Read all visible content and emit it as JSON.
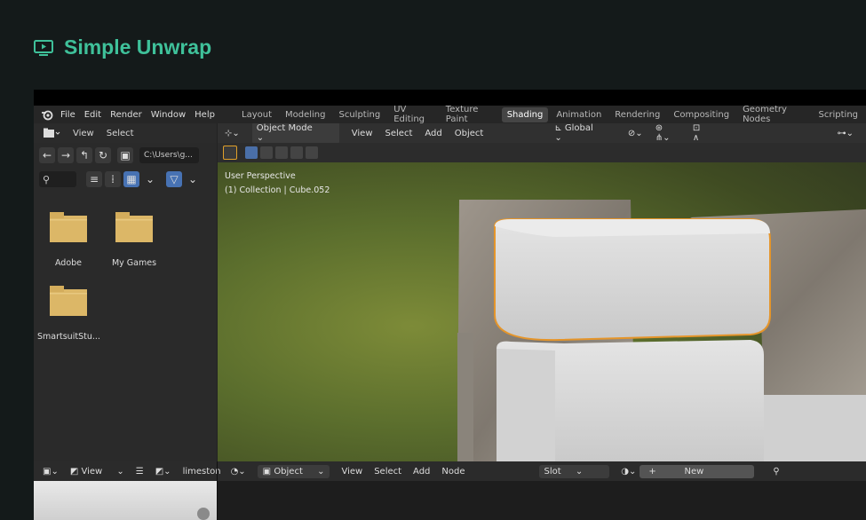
{
  "lesson": {
    "title": "Simple Unwrap",
    "icon": "play-screen-icon"
  },
  "blender": {
    "menu": [
      "File",
      "Edit",
      "Render",
      "Window",
      "Help"
    ],
    "workspace_tabs": [
      "Layout",
      "Modeling",
      "Sculpting",
      "UV Editing",
      "Texture Paint",
      "Shading",
      "Animation",
      "Rendering",
      "Compositing",
      "Geometry Nodes",
      "Scripting"
    ],
    "active_tab": "Shading",
    "file_browser": {
      "header": [
        "View",
        "Select"
      ],
      "path": "C:\\Users\\g...",
      "files": [
        "Adobe",
        "My Games",
        "SmartsuitStu..."
      ]
    },
    "viewport": {
      "mode": "Object Mode",
      "header": [
        "View",
        "Select",
        "Add",
        "Object"
      ],
      "transform": "Global",
      "perspective": "User Perspective",
      "collection": "(1) Collection | Cube.052"
    },
    "image_editor": {
      "view": "View",
      "image_name": "limestone"
    },
    "node_editor": {
      "object": "Object",
      "header": [
        "View",
        "Select",
        "Add",
        "Node"
      ],
      "slot": "Slot",
      "new_label": "New"
    }
  }
}
